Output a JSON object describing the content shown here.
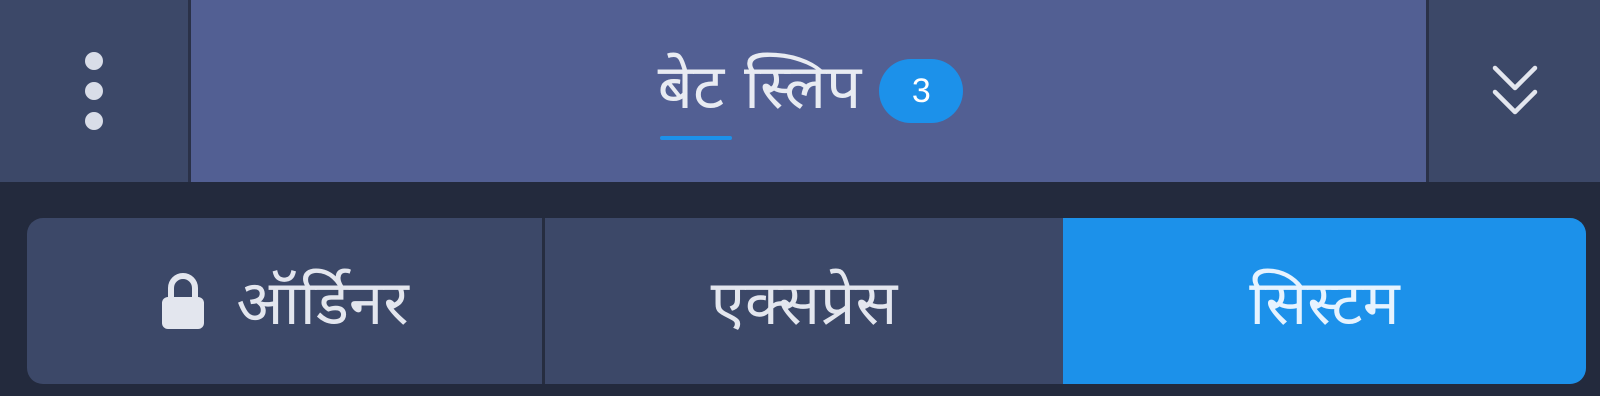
{
  "header": {
    "menu_icon": "more-vertical-icon",
    "title": "बेट स्लिप",
    "badge_count": "3",
    "collapse_icon": "double-chevron-down-icon"
  },
  "tabs": [
    {
      "label": "ऑर्डिनर",
      "icon": "lock-icon",
      "active": false,
      "locked": true
    },
    {
      "label": "एक्सप्रेस",
      "active": false
    },
    {
      "label": "सिस्टम",
      "active": true
    }
  ],
  "colors": {
    "background": "#232a3d",
    "header_side": "#3c4868",
    "header_center": "#525f93",
    "accent": "#1c91ea",
    "text": "#e8ebf2"
  }
}
